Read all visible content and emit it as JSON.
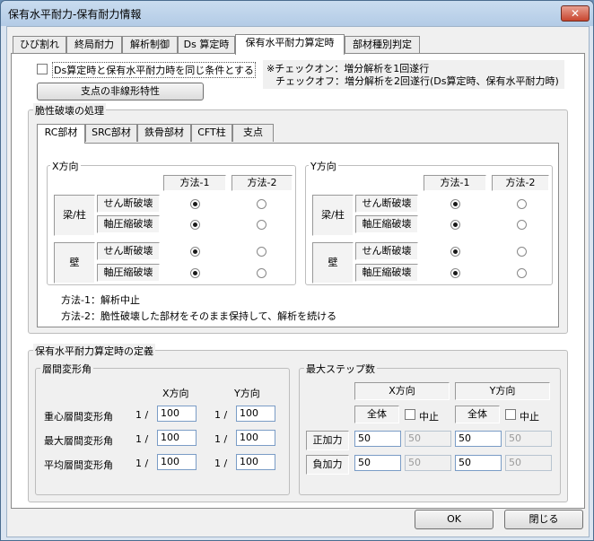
{
  "window": {
    "title": "保有水平耐力-保有耐力情報",
    "close_glyph": "✕"
  },
  "tabs": [
    "ひび割れ",
    "終局耐力",
    "解析制御",
    "Ds 算定時",
    "保有水平耐力算定時",
    "部材種別判定"
  ],
  "top": {
    "same_condition_label": "Ds算定時と保有水平耐力時を同じ条件とする",
    "note_line1": "※チェックオン：増分解析を1回遂行",
    "note_line2": "チェックオフ：増分解析を2回遂行(Ds算定時、保有水平耐力時)",
    "support_button": "支点の非線形特性"
  },
  "brittle": {
    "title": "脆性破壊の処理",
    "tabs": [
      "RC部材",
      "SRC部材",
      "鉄骨部材",
      "CFT柱",
      "支点"
    ],
    "x_dir": "X方向",
    "y_dir": "Y方向",
    "method1": "方法-1",
    "method2": "方法-2",
    "beam_col": "梁/柱",
    "wall": "壁",
    "shear": "せん断破壊",
    "axial": "軸圧縮破壊",
    "note1": "方法-1：解析中止",
    "note2": "方法-2：脆性破壊した部材をそのまま保持して、解析を続ける"
  },
  "definition": {
    "title": "保有水平耐力算定時の定義",
    "drift": {
      "title": "層間変形角",
      "x_dir": "X方向",
      "y_dir": "Y方向",
      "rows": [
        {
          "label": "重心層間変形角",
          "prefix": "1 /",
          "x": "100",
          "y": "100"
        },
        {
          "label": "最大層間変形角",
          "prefix": "1 /",
          "x": "100",
          "y": "100"
        },
        {
          "label": "平均層間変形角",
          "prefix": "1 /",
          "x": "100",
          "y": "100"
        }
      ]
    },
    "steps": {
      "title": "最大ステップ数",
      "x_dir": "X方向",
      "y_dir": "Y方向",
      "all": "全体",
      "stop": "中止",
      "positive": "正加力",
      "negative": "負加力",
      "pos_x_all": "50",
      "pos_x_stop": "50",
      "pos_y_all": "50",
      "pos_y_stop": "50",
      "neg_x_all": "50",
      "neg_x_stop": "50",
      "neg_y_all": "50",
      "neg_y_stop": "50"
    }
  },
  "buttons": {
    "ok": "OK",
    "close": "閉じる"
  }
}
